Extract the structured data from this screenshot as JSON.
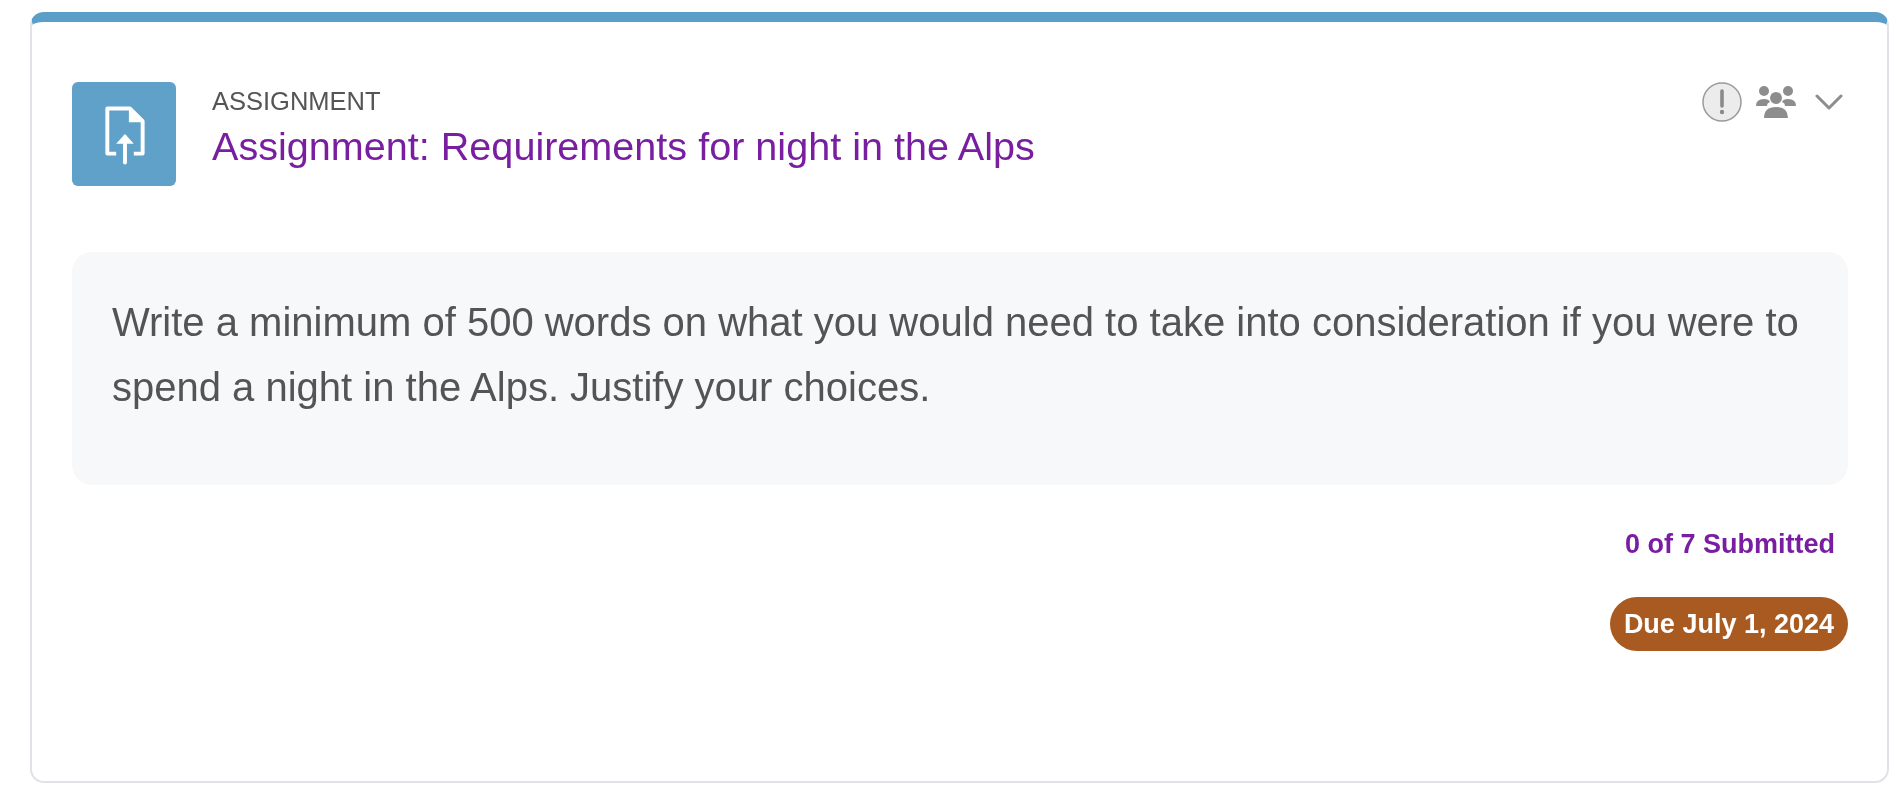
{
  "card": {
    "type_label": "ASSIGNMENT",
    "title": "Assignment: Requirements for night in the Alps",
    "description": "Write a minimum of 500 words on what you would need to take into consideration if you were to spend a night in the Alps. Justify your choices.",
    "submissions": "0 of 7 Submitted",
    "due": "Due July 1, 2024"
  }
}
